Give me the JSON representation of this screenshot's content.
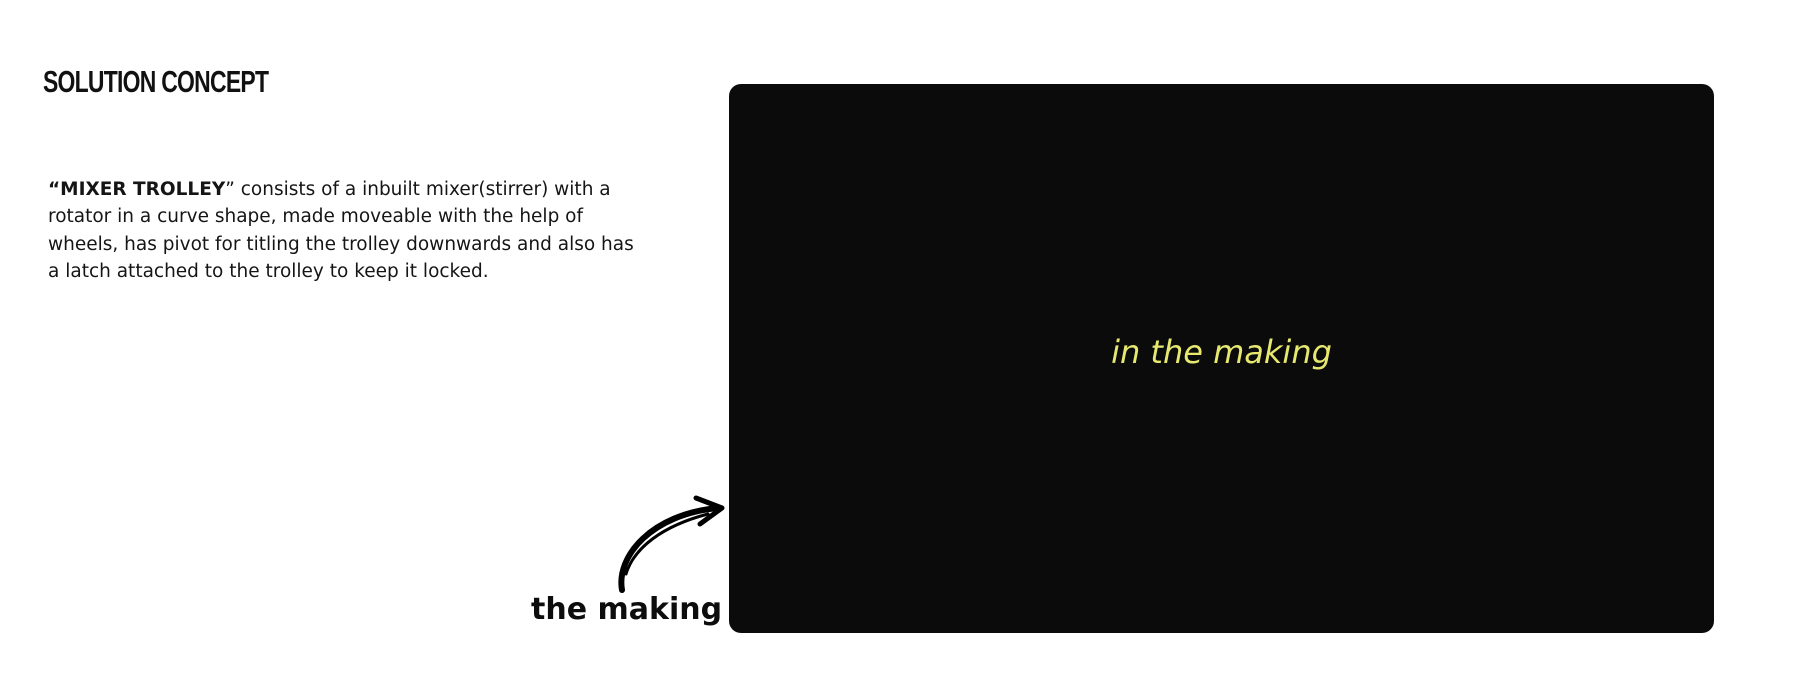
{
  "heading": "SOLUTION CONCEPT",
  "description": {
    "open_quote": "“",
    "product_name": "MIXER TROLLEY",
    "close_quote": "”",
    "body": " consists of a inbuilt mixer(stirrer) with a rotator in a curve shape, made moveable with the help of wheels, has pivot for titling the trolley downwards and also has a latch attached to the trolley to keep it locked."
  },
  "annotation": {
    "label": "the making",
    "icon": "curved-arrow-icon"
  },
  "media_panel": {
    "overlay_text": "in the making",
    "background_color": "#0b0b0b",
    "text_color": "#e6e86f"
  }
}
